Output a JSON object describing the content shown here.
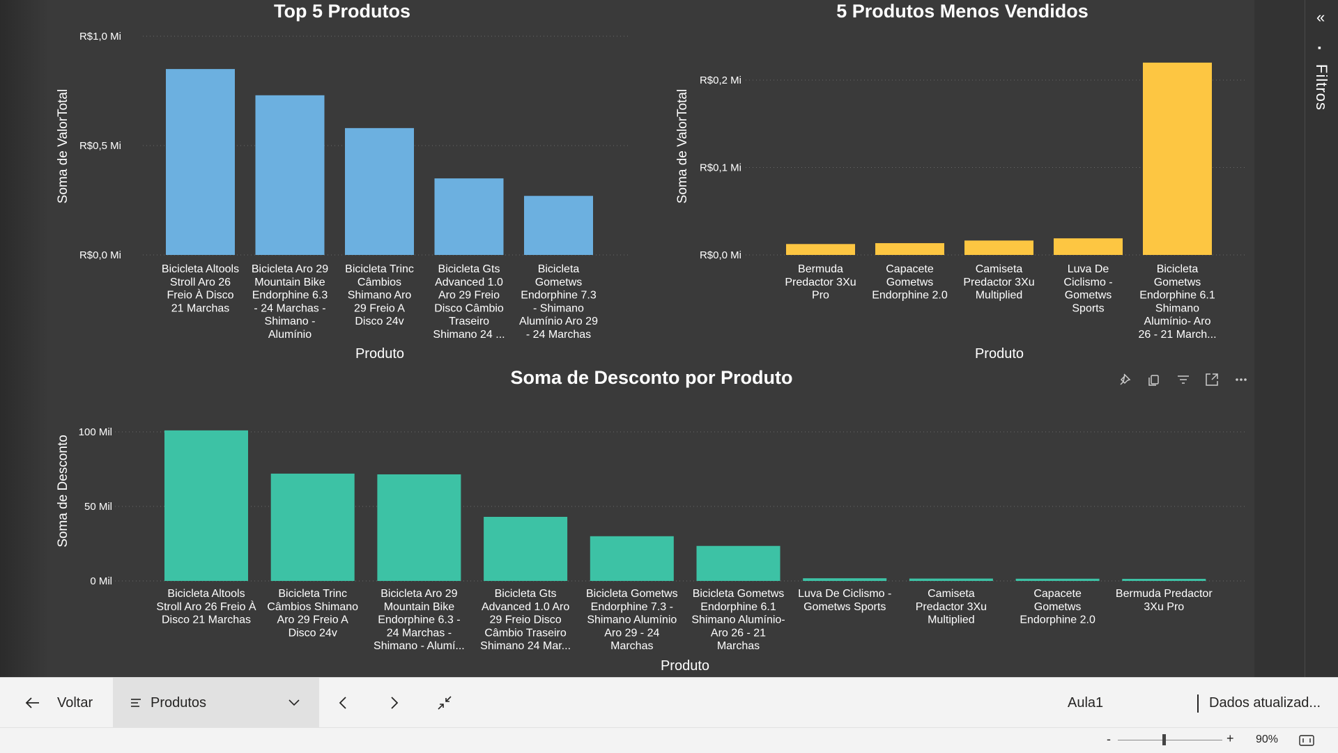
{
  "charts": {
    "top": {
      "title": "Top 5 Produtos",
      "xlabel": "Produto",
      "ylabel": "Soma de ValorTotal",
      "ticks": [
        "R$0,0 Mi",
        "R$0,5 Mi",
        "R$1,0 Mi"
      ],
      "labels": [
        [
          "Bicicleta Altools",
          "Stroll Aro 26",
          "Freio À Disco",
          "21 Marchas"
        ],
        [
          "Bicicleta Aro 29",
          "Mountain Bike",
          "Endorphine 6.3",
          "- 24 Marchas -",
          "Shimano -",
          "Alumínio"
        ],
        [
          "Bicicleta Trinc",
          "Câmbios",
          "Shimano Aro",
          "29 Freio A",
          "Disco 24v"
        ],
        [
          "Bicicleta Gts",
          "Advanced 1.0",
          "Aro 29 Freio",
          "Disco Câmbio",
          "Traseiro",
          "Shimano 24 ..."
        ],
        [
          "Bicicleta",
          "Gometws",
          "Endorphine 7.3",
          "- Shimano",
          "Alumínio Aro 29",
          "- 24 Marchas"
        ]
      ]
    },
    "bottom_sellers": {
      "title": "5 Produtos Menos Vendidos",
      "xlabel": "Produto",
      "ylabel": "Soma de ValorTotal",
      "ticks": [
        "R$0,0 Mi",
        "R$0,1 Mi",
        "R$0,2 Mi"
      ],
      "labels": [
        [
          "Bermuda",
          "Predactor 3Xu",
          "Pro"
        ],
        [
          "Capacete",
          "Gometws",
          "Endorphine 2.0"
        ],
        [
          "Camiseta",
          "Predactor 3Xu",
          "Multiplied"
        ],
        [
          "Luva De",
          "Ciclismo -",
          "Gometws",
          "Sports"
        ],
        [
          "Bicicleta",
          "Gometws",
          "Endorphine 6.1",
          "Shimano",
          "Alumínio- Aro",
          "26 - 21 March..."
        ]
      ]
    },
    "discount": {
      "title": "Soma de Desconto por Produto",
      "xlabel": "Produto",
      "ylabel": "Soma de Desconto",
      "ticks": [
        "0 Mil",
        "50 Mil",
        "100 Mil"
      ],
      "labels": [
        [
          "Bicicleta Altools",
          "Stroll Aro 26 Freio À",
          "Disco 21 Marchas"
        ],
        [
          "Bicicleta Trinc",
          "Câmbios Shimano",
          "Aro 29 Freio A",
          "Disco 24v"
        ],
        [
          "Bicicleta Aro 29",
          "Mountain Bike",
          "Endorphine 6.3 -",
          "24 Marchas -",
          "Shimano - Alumí..."
        ],
        [
          "Bicicleta Gts",
          "Advanced 1.0 Aro",
          "29 Freio Disco",
          "Câmbio Traseiro",
          "Shimano 24 Mar..."
        ],
        [
          "Bicicleta Gometws",
          "Endorphine 7.3 -",
          "Shimano Alumínio",
          "Aro 29 - 24",
          "Marchas"
        ],
        [
          "Bicicleta Gometws",
          "Endorphine 6.1",
          "Shimano Alumínio-",
          "Aro 26 - 21",
          "Marchas"
        ],
        [
          "Luva De Ciclismo -",
          "Gometws Sports"
        ],
        [
          "Camiseta",
          "Predactor 3Xu",
          "Multiplied"
        ],
        [
          "Capacete",
          "Gometws",
          "Endorphine 2.0"
        ],
        [
          "Bermuda Predactor",
          "3Xu Pro"
        ]
      ]
    }
  },
  "chart_data": [
    {
      "type": "bar",
      "title": "Top 5 Produtos",
      "xlabel": "Produto",
      "ylabel": "Soma de ValorTotal",
      "categories": [
        "Bicicleta Altools Stroll Aro 26 Freio À Disco 21 Marchas",
        "Bicicleta Aro 29 Mountain Bike Endorphine 6.3 - 24 Marchas - Shimano - Alumínio",
        "Bicicleta Trinc Câmbios Shimano Aro 29 Freio A Disco 24v",
        "Bicicleta Gts Advanced 1.0 Aro 29 Freio Disco Câmbio Traseiro Shimano 24 ...",
        "Bicicleta Gometws Endorphine 7.3 - Shimano Alumínio Aro 29 - 24 Marchas"
      ],
      "values": [
        0.85,
        0.73,
        0.58,
        0.35,
        0.27
      ],
      "unit": "R$ Mi",
      "ylim": [
        0,
        1.0
      ],
      "color": "#6CB0E0",
      "grid": true
    },
    {
      "type": "bar",
      "title": "5 Produtos Menos Vendidos",
      "xlabel": "Produto",
      "ylabel": "Soma de ValorTotal",
      "categories": [
        "Bermuda Predactor 3Xu Pro",
        "Capacete Gometws Endorphine 2.0",
        "Camiseta Predactor 3Xu Multiplied",
        "Luva De Ciclismo - Gometws Sports",
        "Bicicleta Gometws Endorphine 6.1 Shimano Alumínio- Aro 26 - 21 March..."
      ],
      "values": [
        0.0125,
        0.0135,
        0.0165,
        0.019,
        0.22
      ],
      "unit": "R$ Mi",
      "ylim": [
        0,
        0.2
      ],
      "color": "#FDC642",
      "grid": true
    },
    {
      "type": "bar",
      "title": "Soma de Desconto por Produto",
      "xlabel": "Produto",
      "ylabel": "Soma de Desconto",
      "categories": [
        "Bicicleta Altools Stroll Aro 26 Freio À Disco 21 Marchas",
        "Bicicleta Trinc Câmbios Shimano Aro 29 Freio A Disco 24v",
        "Bicicleta Aro 29 Mountain Bike Endorphine 6.3 - 24 Marchas - Shimano - Alumí...",
        "Bicicleta Gts Advanced 1.0 Aro 29 Freio Disco Câmbio Traseiro Shimano 24 Mar...",
        "Bicicleta Gometws Endorphine 7.3 - Shimano Alumínio Aro 29 - 24 Marchas",
        "Bicicleta Gometws Endorphine 6.1 Shimano Alumínio- Aro 26 - 21 Marchas",
        "Luva De Ciclismo - Gometws Sports",
        "Camiseta Predactor 3Xu Multiplied",
        "Capacete Gometws Endorphine 2.0",
        "Bermuda Predactor 3Xu Pro"
      ],
      "values": [
        101,
        72,
        71.5,
        43,
        30,
        23.5,
        1.8,
        1.6,
        1.5,
        1.4
      ],
      "unit": "Mil",
      "ylim": [
        0,
        100
      ],
      "color": "#3DC2A5",
      "grid": true
    }
  ],
  "bottom_bar": {
    "back_label": "Voltar",
    "page_label": "Produtos",
    "report_name": "Aula1",
    "refresh_label": "Dados atualizad..."
  },
  "status": {
    "zoom_minus": "-",
    "zoom_plus": "+",
    "zoom_level": "90%"
  },
  "filters": {
    "label": "Filtros"
  }
}
